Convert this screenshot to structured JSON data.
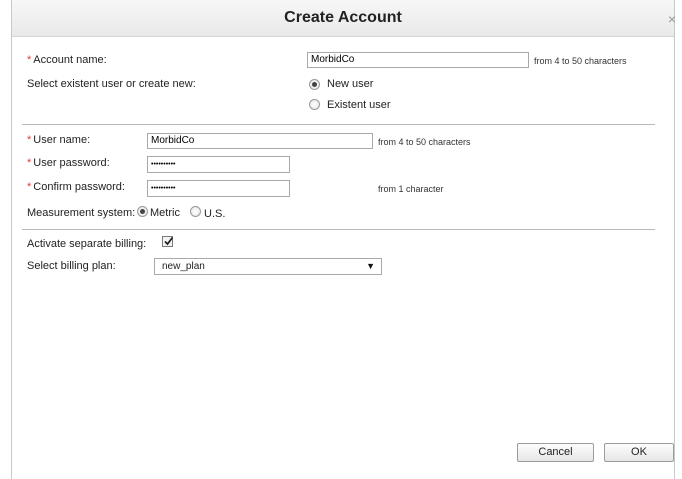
{
  "dialog": {
    "title": "Create Account",
    "close_glyph": "×"
  },
  "account": {
    "name_label": "Account name:",
    "name_value": "MorbidCo",
    "name_hint": "from 4 to 50 characters",
    "select_user_label": "Select existent user or create new:",
    "new_user_label": "New user",
    "existent_user_label": "Existent user",
    "selected_user_option": "New user"
  },
  "user": {
    "name_label": "User name:",
    "name_value": "MorbidCo",
    "name_hint": "from 4 to 50 characters",
    "password_label": "User password:",
    "password_value": "••••••••••",
    "confirm_label": "Confirm password:",
    "confirm_value": "••••••••••",
    "confirm_hint": "from 1 character",
    "measurement_label": "Measurement system:",
    "metric_label": "Metric",
    "us_label": "U.S.",
    "selected_measurement": "Metric"
  },
  "billing": {
    "activate_label": "Activate separate billing:",
    "activate_checked": true,
    "plan_label": "Select billing plan:",
    "plan_value": "new_plan"
  },
  "buttons": {
    "cancel": "Cancel",
    "ok": "OK"
  },
  "required_marker": "*"
}
